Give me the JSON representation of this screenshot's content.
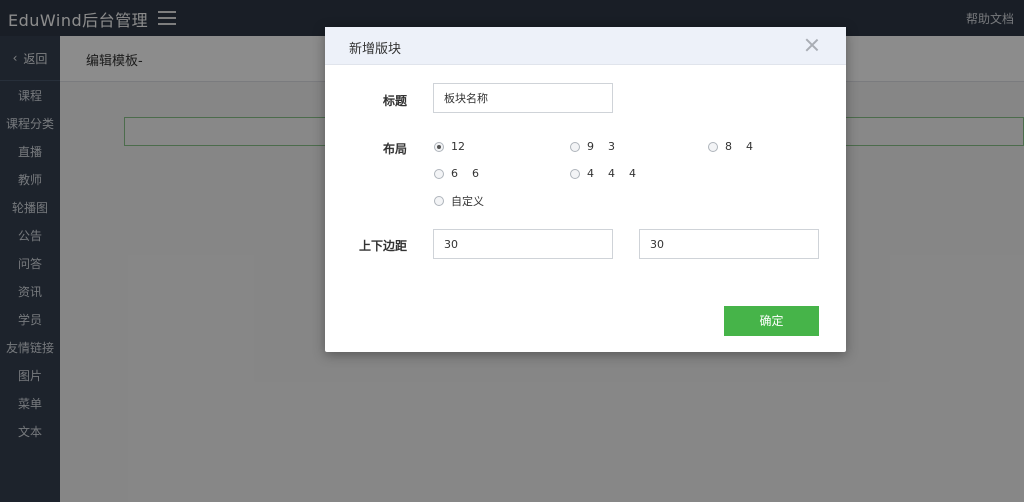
{
  "app": {
    "brand": "EduWind后台管理",
    "help": "帮助文档"
  },
  "sidebar": {
    "back_label": "返回",
    "items": [
      {
        "label": "课程"
      },
      {
        "label": "课程分类"
      },
      {
        "label": "直播"
      },
      {
        "label": "教师"
      },
      {
        "label": "轮播图"
      },
      {
        "label": "公告"
      },
      {
        "label": "问答"
      },
      {
        "label": "资讯"
      },
      {
        "label": "学员"
      },
      {
        "label": "友情链接"
      },
      {
        "label": "图片"
      },
      {
        "label": "菜单"
      },
      {
        "label": "文本"
      }
    ]
  },
  "main": {
    "page_title": "编辑模板-"
  },
  "modal": {
    "title": "新增版块",
    "fields": {
      "title_label": "标题",
      "title_value": "板块名称",
      "layout_label": "布局",
      "layout_options": [
        {
          "label": "12",
          "checked": true
        },
        {
          "label": "9    3",
          "checked": false
        },
        {
          "label": "8    4",
          "checked": false
        },
        {
          "label": "6    6",
          "checked": false
        },
        {
          "label": "4    4    4",
          "checked": false
        },
        {
          "label": "自定义",
          "checked": false
        }
      ],
      "margin_label": "上下边距",
      "margin_top_value": "30",
      "margin_bottom_value": "30"
    },
    "confirm_label": "确定"
  },
  "colors": {
    "topbar": "#2e3846",
    "sidebar": "#364150",
    "modal_header": "#edf1f9",
    "confirm": "#46b449"
  }
}
